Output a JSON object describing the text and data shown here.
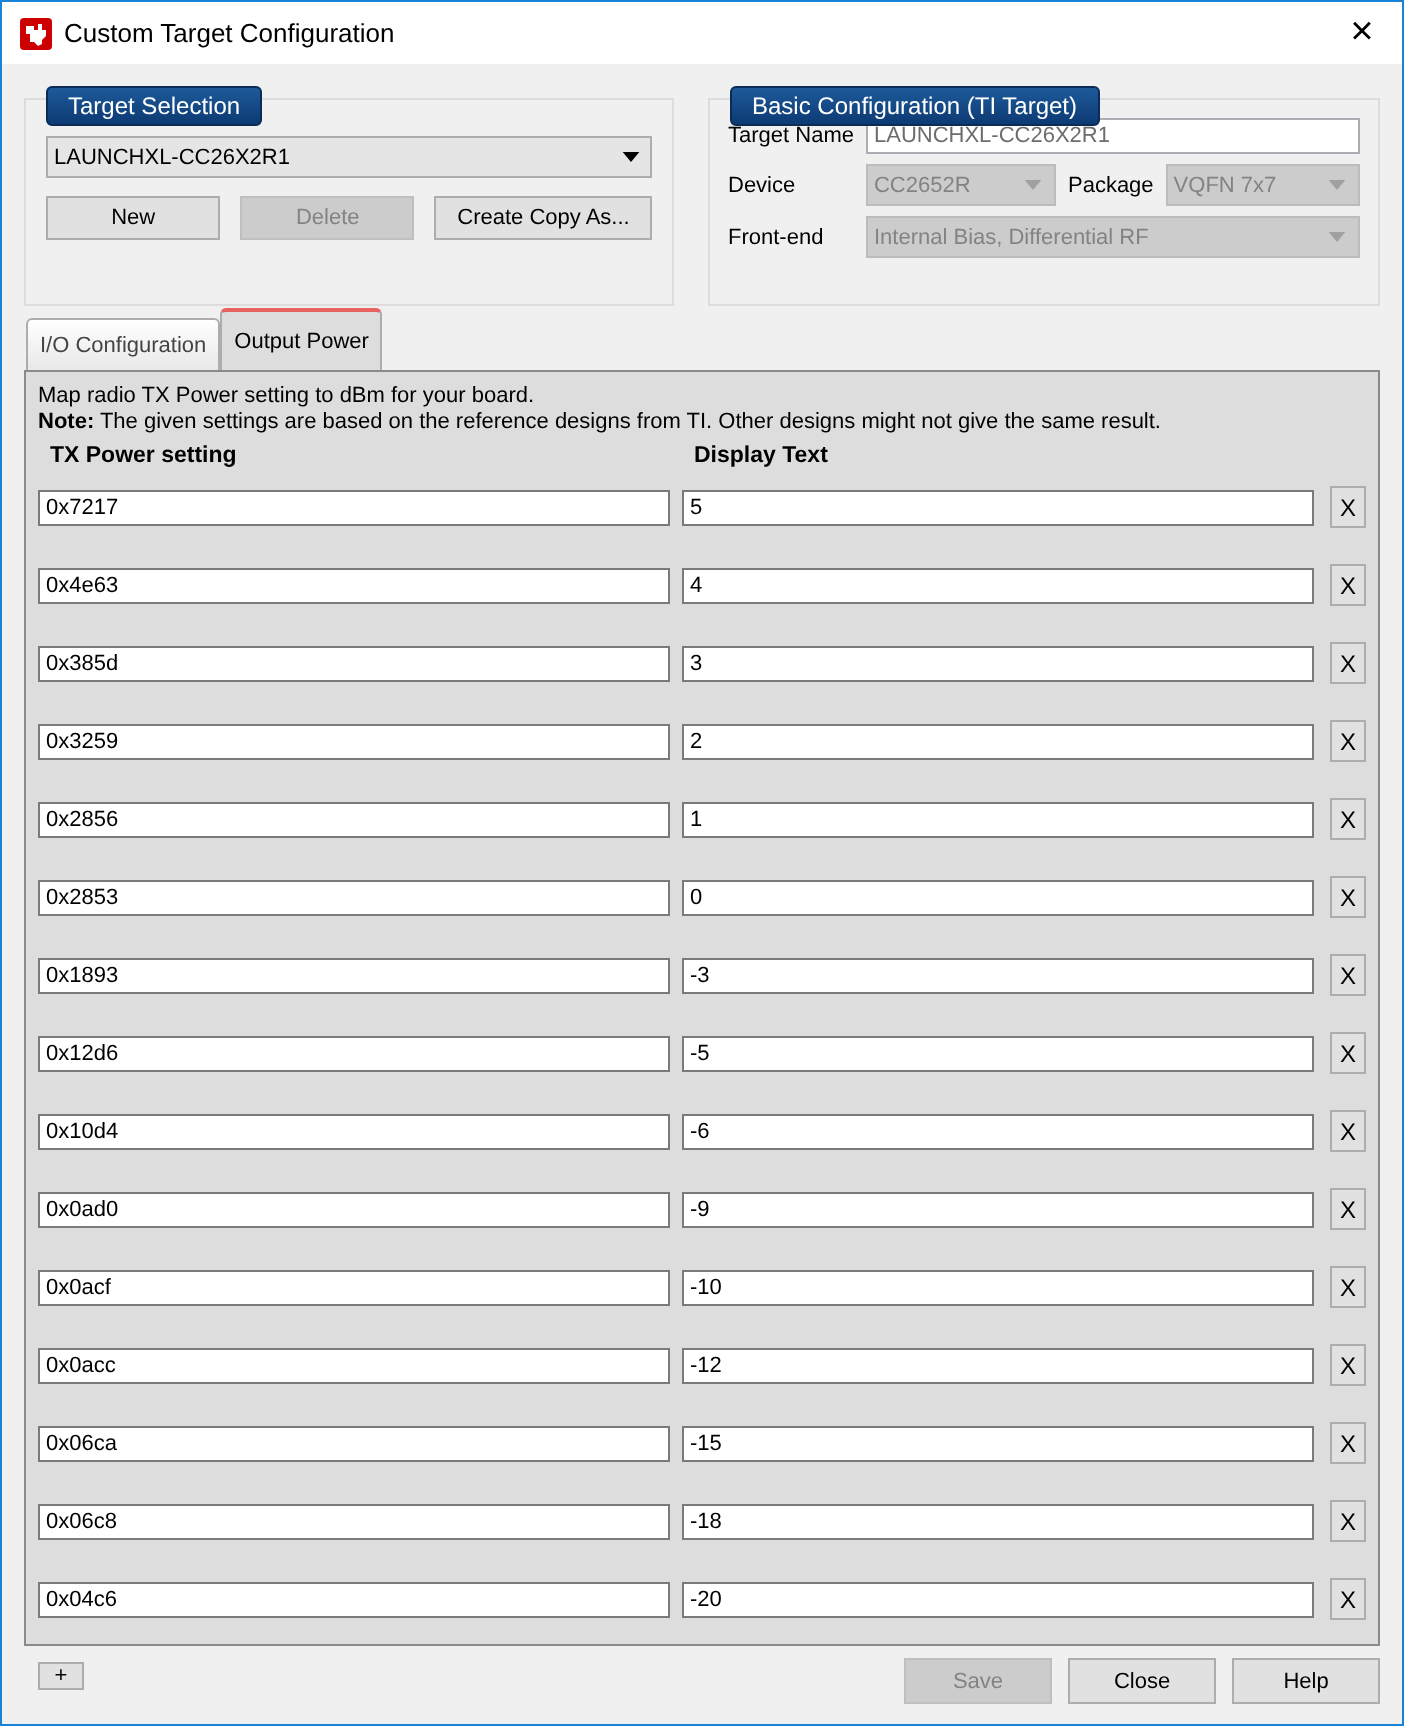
{
  "window": {
    "title": "Custom Target Configuration",
    "close": "×"
  },
  "target_selection": {
    "legend": "Target Selection",
    "target": "LAUNCHXL-CC26X2R1",
    "buttons": [
      {
        "label": "New",
        "disabled": false
      },
      {
        "label": "Delete",
        "disabled": true
      },
      {
        "label": "Create Copy As...",
        "disabled": false
      }
    ]
  },
  "basic_configuration": {
    "legend": "Basic Configuration (TI Target)",
    "fields": [
      {
        "label": "Target Name",
        "value": "LAUNCHXL-CC26X2R1",
        "kind": "text"
      },
      {
        "label": "Device",
        "value": "CC2652R",
        "kind": "select"
      },
      {
        "label": "Package",
        "value": "VQFN 7x7",
        "kind": "select"
      },
      {
        "label": "Front-end",
        "value": "Internal Bias, Differential RF",
        "kind": "select"
      }
    ]
  },
  "tabs": [
    {
      "label": "I/O Configuration",
      "selected": false
    },
    {
      "label": "Output Power",
      "selected": true
    }
  ],
  "output_power": {
    "intro": "Map radio TX Power setting to dBm for your board.",
    "note": "**Note:** The given settings are based on the reference designs from TI. Other designs might not give the same result.",
    "columns": [
      "TX Power setting",
      "Display Text"
    ],
    "rows": [
      {
        "setting": "0x7217",
        "text": "5",
        "remove": "X"
      },
      {
        "setting": "0x4e63",
        "text": "4",
        "remove": "X"
      },
      {
        "setting": "0x385d",
        "text": "3",
        "remove": "X"
      },
      {
        "setting": "0x3259",
        "text": "2",
        "remove": "X"
      },
      {
        "setting": "0x2856",
        "text": "1",
        "remove": "X"
      },
      {
        "setting": "0x2853",
        "text": "0",
        "remove": "X"
      },
      {
        "setting": "0x1893",
        "text": "-3",
        "remove": "X"
      },
      {
        "setting": "0x12d6",
        "text": "-5",
        "remove": "X"
      },
      {
        "setting": "0x10d4",
        "text": "-6",
        "remove": "X"
      },
      {
        "setting": "0x0ad0",
        "text": "-9",
        "remove": "X"
      },
      {
        "setting": "0x0acf",
        "text": "-10",
        "remove": "X"
      },
      {
        "setting": "0x0acc",
        "text": "-12",
        "remove": "X"
      },
      {
        "setting": "0x06ca",
        "text": "-15",
        "remove": "X"
      },
      {
        "setting": "0x06c8",
        "text": "-18",
        "remove": "X"
      },
      {
        "setting": "0x04c6",
        "text": "-20",
        "remove": "X"
      }
    ],
    "add": "+"
  },
  "buttons": [
    {
      "label": "Save",
      "disabled": true
    },
    {
      "label": "Close",
      "disabled": false
    },
    {
      "label": "Help",
      "disabled": false
    }
  ]
}
